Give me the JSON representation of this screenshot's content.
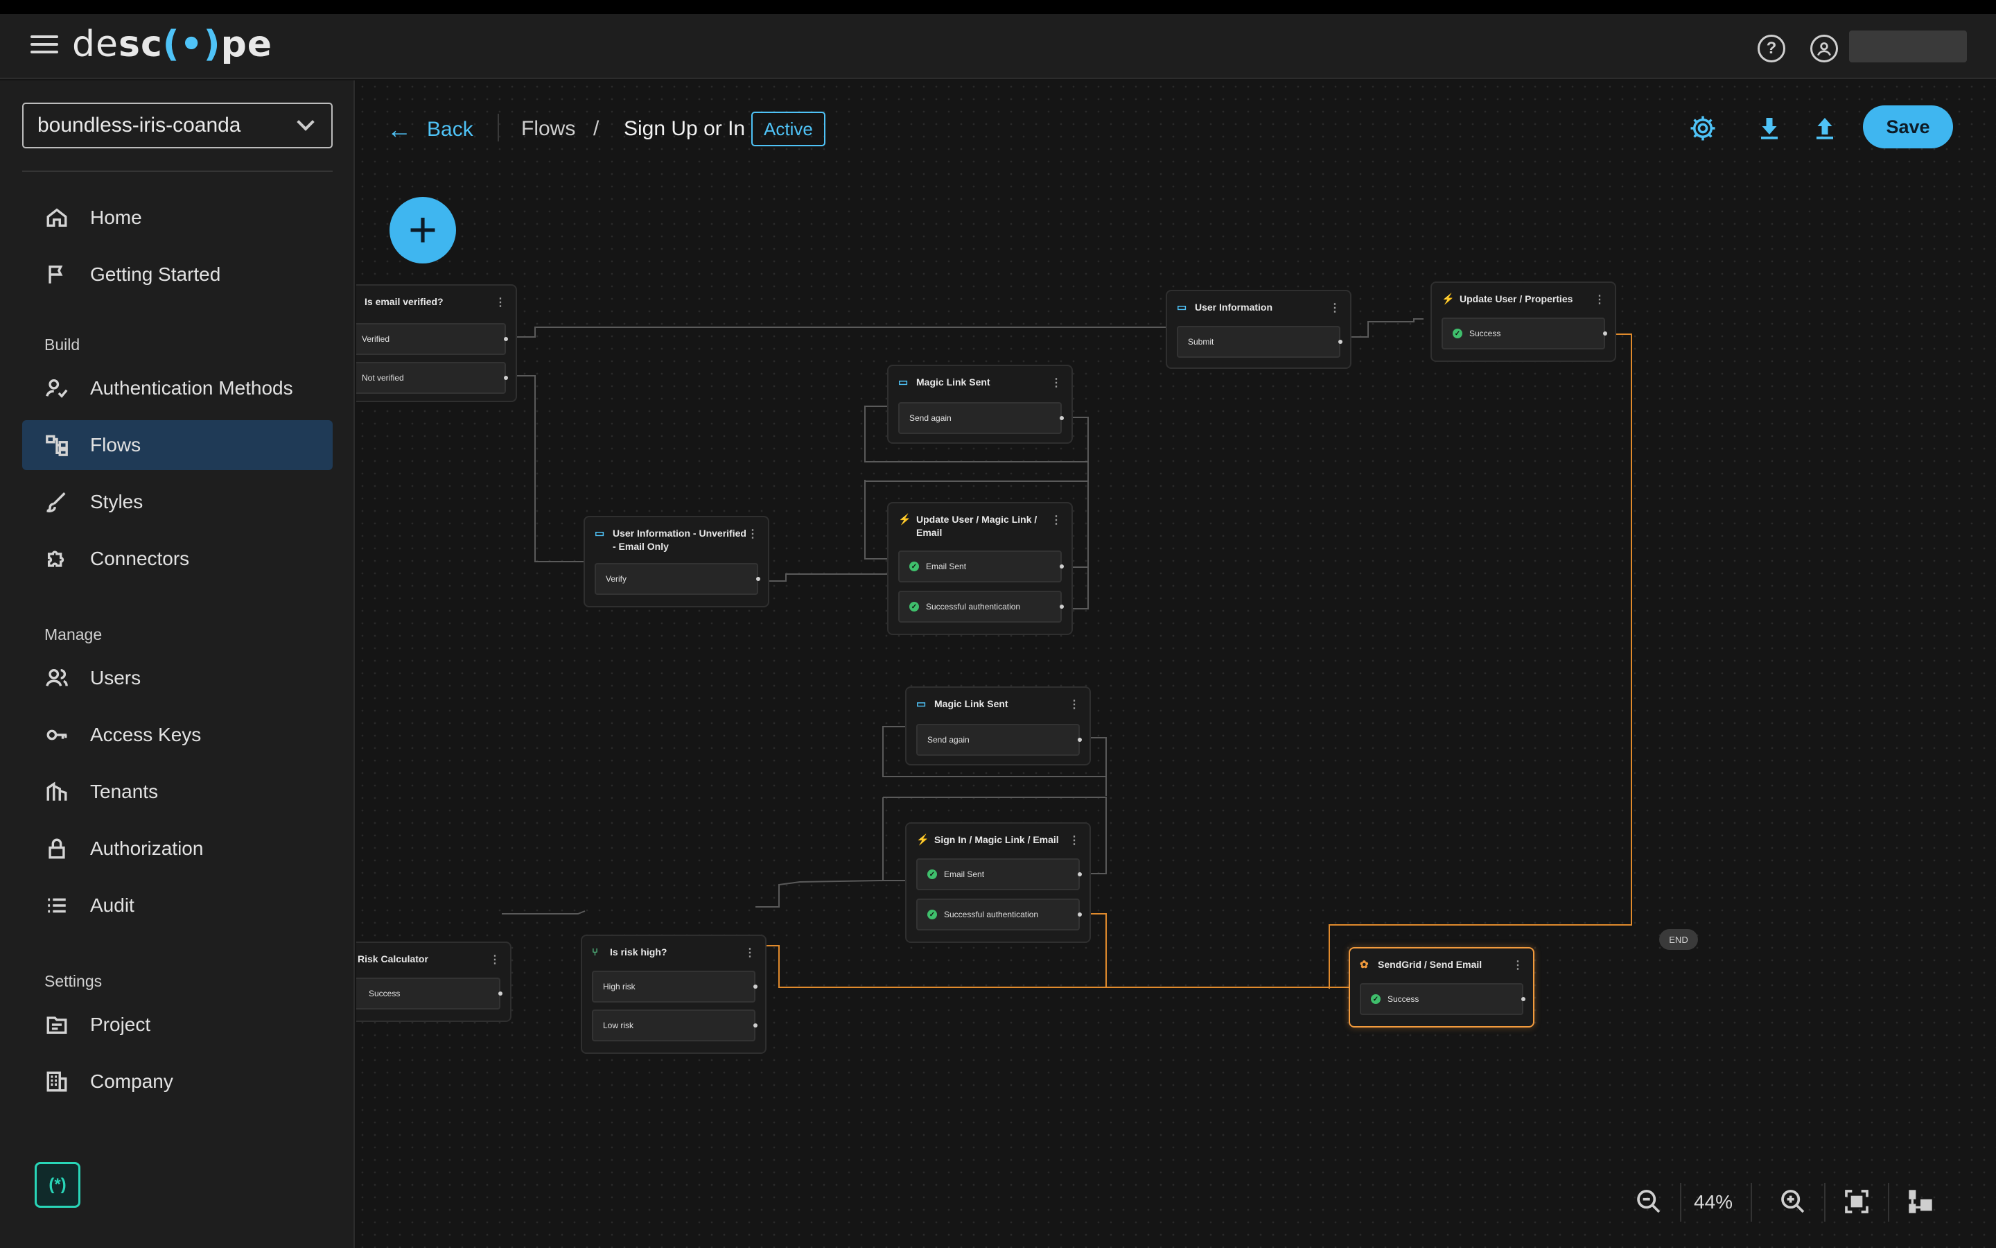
{
  "app": {
    "logo_light": "desc",
    "logo_mid": "o",
    "logo_tail": "pe",
    "logo_lead": "de"
  },
  "sidebar": {
    "project": "boundless-iris-coanda",
    "items_top": [
      {
        "label": "Home",
        "icon": "home-icon"
      },
      {
        "label": "Getting Started",
        "icon": "flag-icon"
      }
    ],
    "sections": [
      {
        "label": "Build"
      },
      {
        "label": "Manage"
      },
      {
        "label": "Settings"
      }
    ],
    "build": [
      {
        "label": "Authentication Methods",
        "icon": "user-check-icon"
      },
      {
        "label": "Flows",
        "icon": "flows-icon",
        "active": true
      },
      {
        "label": "Styles",
        "icon": "brush-icon"
      },
      {
        "label": "Connectors",
        "icon": "puzzle-icon"
      }
    ],
    "manage": [
      {
        "label": "Users",
        "icon": "users-icon"
      },
      {
        "label": "Access Keys",
        "icon": "key-icon"
      },
      {
        "label": "Tenants",
        "icon": "tenants-icon"
      },
      {
        "label": "Authorization",
        "icon": "lock-icon"
      },
      {
        "label": "Audit",
        "icon": "list-icon"
      }
    ],
    "settings": [
      {
        "label": "Project",
        "icon": "folder-icon"
      },
      {
        "label": "Company",
        "icon": "building-icon"
      }
    ]
  },
  "header": {
    "back": "Back",
    "crumb_flows": "Flows",
    "crumb_sep": "/",
    "crumb_current": "Sign Up or In",
    "status": "Active",
    "save": "Save"
  },
  "canvas": {
    "end_label": "END",
    "zoom": "44%",
    "nodes": {
      "email_verified": {
        "title": "Is email verified?",
        "outlets": [
          "Verified",
          "Not verified"
        ]
      },
      "user_info_unverified": {
        "title": "User Information - Unverified - Email Only",
        "outlets": [
          "Verify"
        ]
      },
      "magic_link_sent_1": {
        "title": "Magic Link Sent",
        "outlets": [
          "Send again"
        ]
      },
      "update_user_magic": {
        "title": "Update User / Magic Link / Email",
        "outlets": [
          "Email Sent",
          "Successful authentication"
        ]
      },
      "user_information": {
        "title": "User Information",
        "outlets": [
          "Submit"
        ]
      },
      "update_user_props": {
        "title": "Update User / Properties",
        "outlets": [
          "Success"
        ]
      },
      "magic_link_sent_2": {
        "title": "Magic Link Sent",
        "outlets": [
          "Send again"
        ]
      },
      "sign_in_magic": {
        "title": "Sign In / Magic Link / Email",
        "outlets": [
          "Email Sent",
          "Successful authentication"
        ]
      },
      "risk_calculator": {
        "title": "Risk Calculator",
        "outlets": [
          "Success"
        ]
      },
      "is_risk_high": {
        "title": "Is risk high?",
        "outlets": [
          "High risk",
          "Low risk"
        ]
      },
      "sendgrid": {
        "title": "SendGrid / Send Email",
        "outlets": [
          "Success"
        ]
      }
    }
  },
  "colors": {
    "accent": "#3fb6f0",
    "selected": "#f39b3d",
    "success": "#3fbf6c"
  }
}
